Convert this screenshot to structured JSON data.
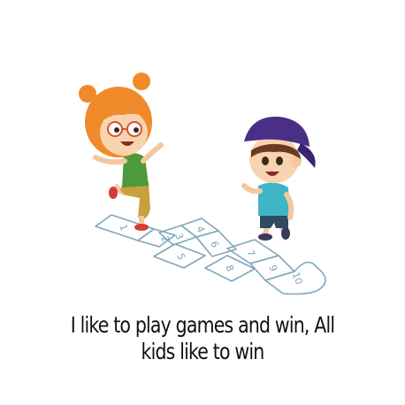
{
  "caption": {
    "line1": "I like to play games and win, All",
    "line2": "kids like to win"
  },
  "hopscotch": {
    "squares": [
      "1",
      "2",
      "3",
      "4",
      "5",
      "6",
      "7",
      "8",
      "9",
      "10"
    ]
  },
  "colors": {
    "background": "#ffffff",
    "girl_hair": "#f08a2a",
    "girl_shirt": "#4d9a3a",
    "girl_pants": "#c9a13c",
    "boy_cap": "#4a2f86",
    "boy_shirt": "#3fb6c6",
    "boy_shorts": "#2f4a63",
    "chalk_lines": "#7ea7bd",
    "text": "#111111"
  }
}
